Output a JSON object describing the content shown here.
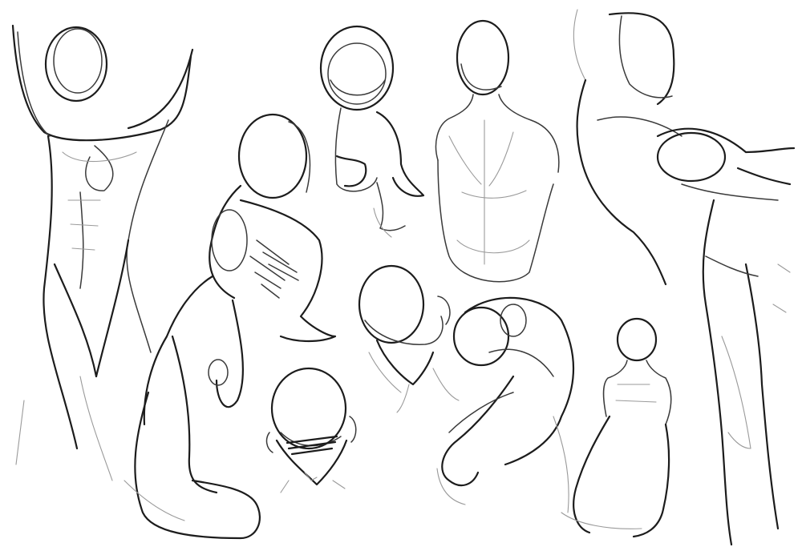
{
  "canvas": {
    "background": "#ffffff",
    "ink": "#1c1c1c",
    "construction": "#9a9a9a"
  },
  "figures": [
    {
      "name": "torso-arms-raised"
    },
    {
      "name": "crouching-figure-foreshortened"
    },
    {
      "name": "head-top-view-small-body"
    },
    {
      "name": "back-view-torso"
    },
    {
      "name": "twisting-torso-arm-extended"
    },
    {
      "name": "head-tilted-down"
    },
    {
      "name": "head-top-view-shaded-brow"
    },
    {
      "name": "hunched-figure-arm"
    },
    {
      "name": "small-seated-figure"
    }
  ]
}
